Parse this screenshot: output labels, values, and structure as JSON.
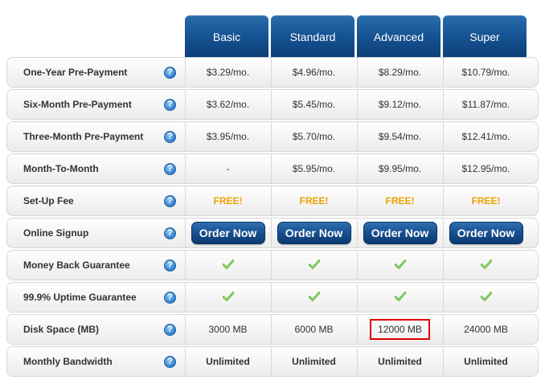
{
  "plans": [
    "Basic",
    "Standard",
    "Advanced",
    "Super"
  ],
  "rows": [
    {
      "label": "One-Year Pre-Payment",
      "type": "text",
      "values": [
        "$3.29/mo.",
        "$4.96/mo.",
        "$8.29/mo.",
        "$10.79/mo."
      ]
    },
    {
      "label": "Six-Month Pre-Payment",
      "type": "text",
      "values": [
        "$3.62/mo.",
        "$5.45/mo.",
        "$9.12/mo.",
        "$11.87/mo."
      ]
    },
    {
      "label": "Three-Month Pre-Payment",
      "type": "text",
      "values": [
        "$3.95/mo.",
        "$5.70/mo.",
        "$9.54/mo.",
        "$12.41/mo."
      ]
    },
    {
      "label": "Month-To-Month",
      "type": "text",
      "values": [
        "-",
        "$5.95/mo.",
        "$9.95/mo.",
        "$12.95/mo."
      ]
    },
    {
      "label": "Set-Up Fee",
      "type": "free",
      "values": [
        "FREE!",
        "FREE!",
        "FREE!",
        "FREE!"
      ]
    },
    {
      "label": "Online Signup",
      "type": "button",
      "values": [
        "Order Now",
        "Order Now",
        "Order Now",
        "Order Now"
      ]
    },
    {
      "label": "Money Back Guarantee",
      "type": "check",
      "values": [
        "check-icon",
        "check-icon",
        "check-icon",
        "check-icon"
      ]
    },
    {
      "label": "99.9% Uptime Guarantee",
      "type": "check",
      "values": [
        "check-icon",
        "check-icon",
        "check-icon",
        "check-icon"
      ]
    },
    {
      "label": "Disk Space (MB)",
      "type": "text",
      "values": [
        "3000 MB",
        "6000 MB",
        "12000 MB",
        "24000 MB"
      ]
    },
    {
      "label": "Monthly Bandwidth",
      "type": "bold",
      "values": [
        "Unlimited",
        "Unlimited",
        "Unlimited",
        "Unlimited"
      ]
    }
  ],
  "help_icon_glyph": "?",
  "highlight": {
    "row": 8,
    "col": 2,
    "color": "#e00000"
  },
  "colors": {
    "header_blue": "#175495",
    "free_orange": "#f0a000",
    "check_green": "#4caf1e"
  }
}
